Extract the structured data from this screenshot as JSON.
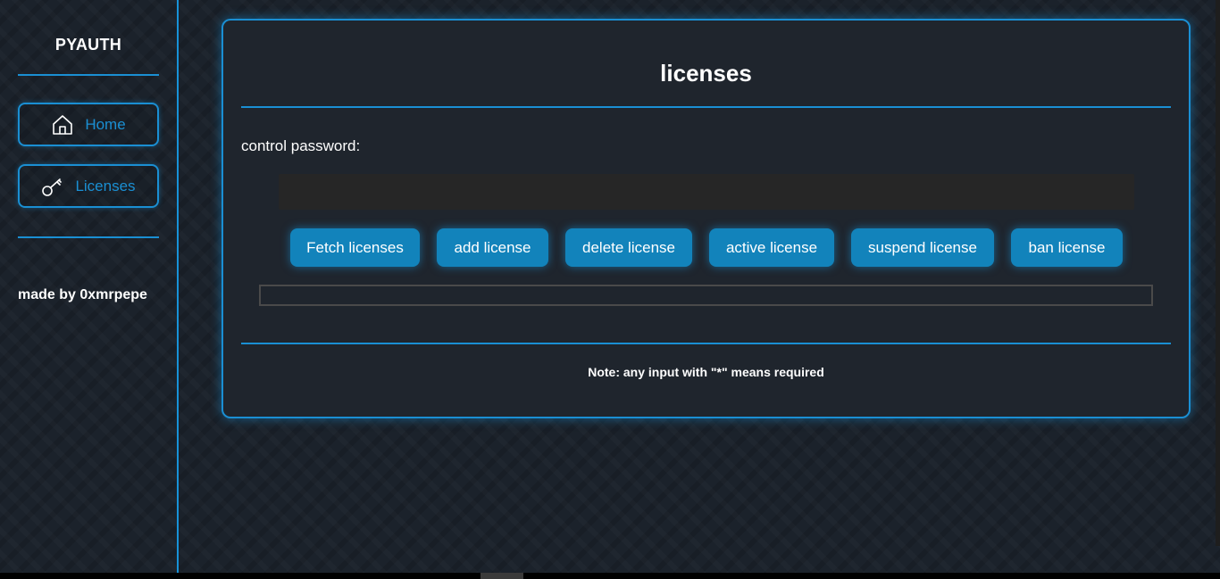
{
  "sidebar": {
    "brand": "PYAUTH",
    "nav": {
      "home": {
        "label": "Home",
        "icon": "home-icon"
      },
      "licenses": {
        "label": "Licenses",
        "icon": "key-icon"
      }
    },
    "credit": "made by 0xmrpepe"
  },
  "main": {
    "title": "licenses",
    "password_label": "control password:",
    "password_value": "",
    "buttons": {
      "fetch": "Fetch licenses",
      "add": "add license",
      "delete": "delete license",
      "active": "active license",
      "suspend": "suspend license",
      "ban": "ban license"
    },
    "output": "",
    "note": "Note: any input with \"*\" means required"
  },
  "colors": {
    "accent": "#1a8fd3",
    "button_bg": "#1283bb",
    "page_bg": "#1b222b",
    "card_bg": "#1f252d",
    "input_bg": "#262626"
  }
}
